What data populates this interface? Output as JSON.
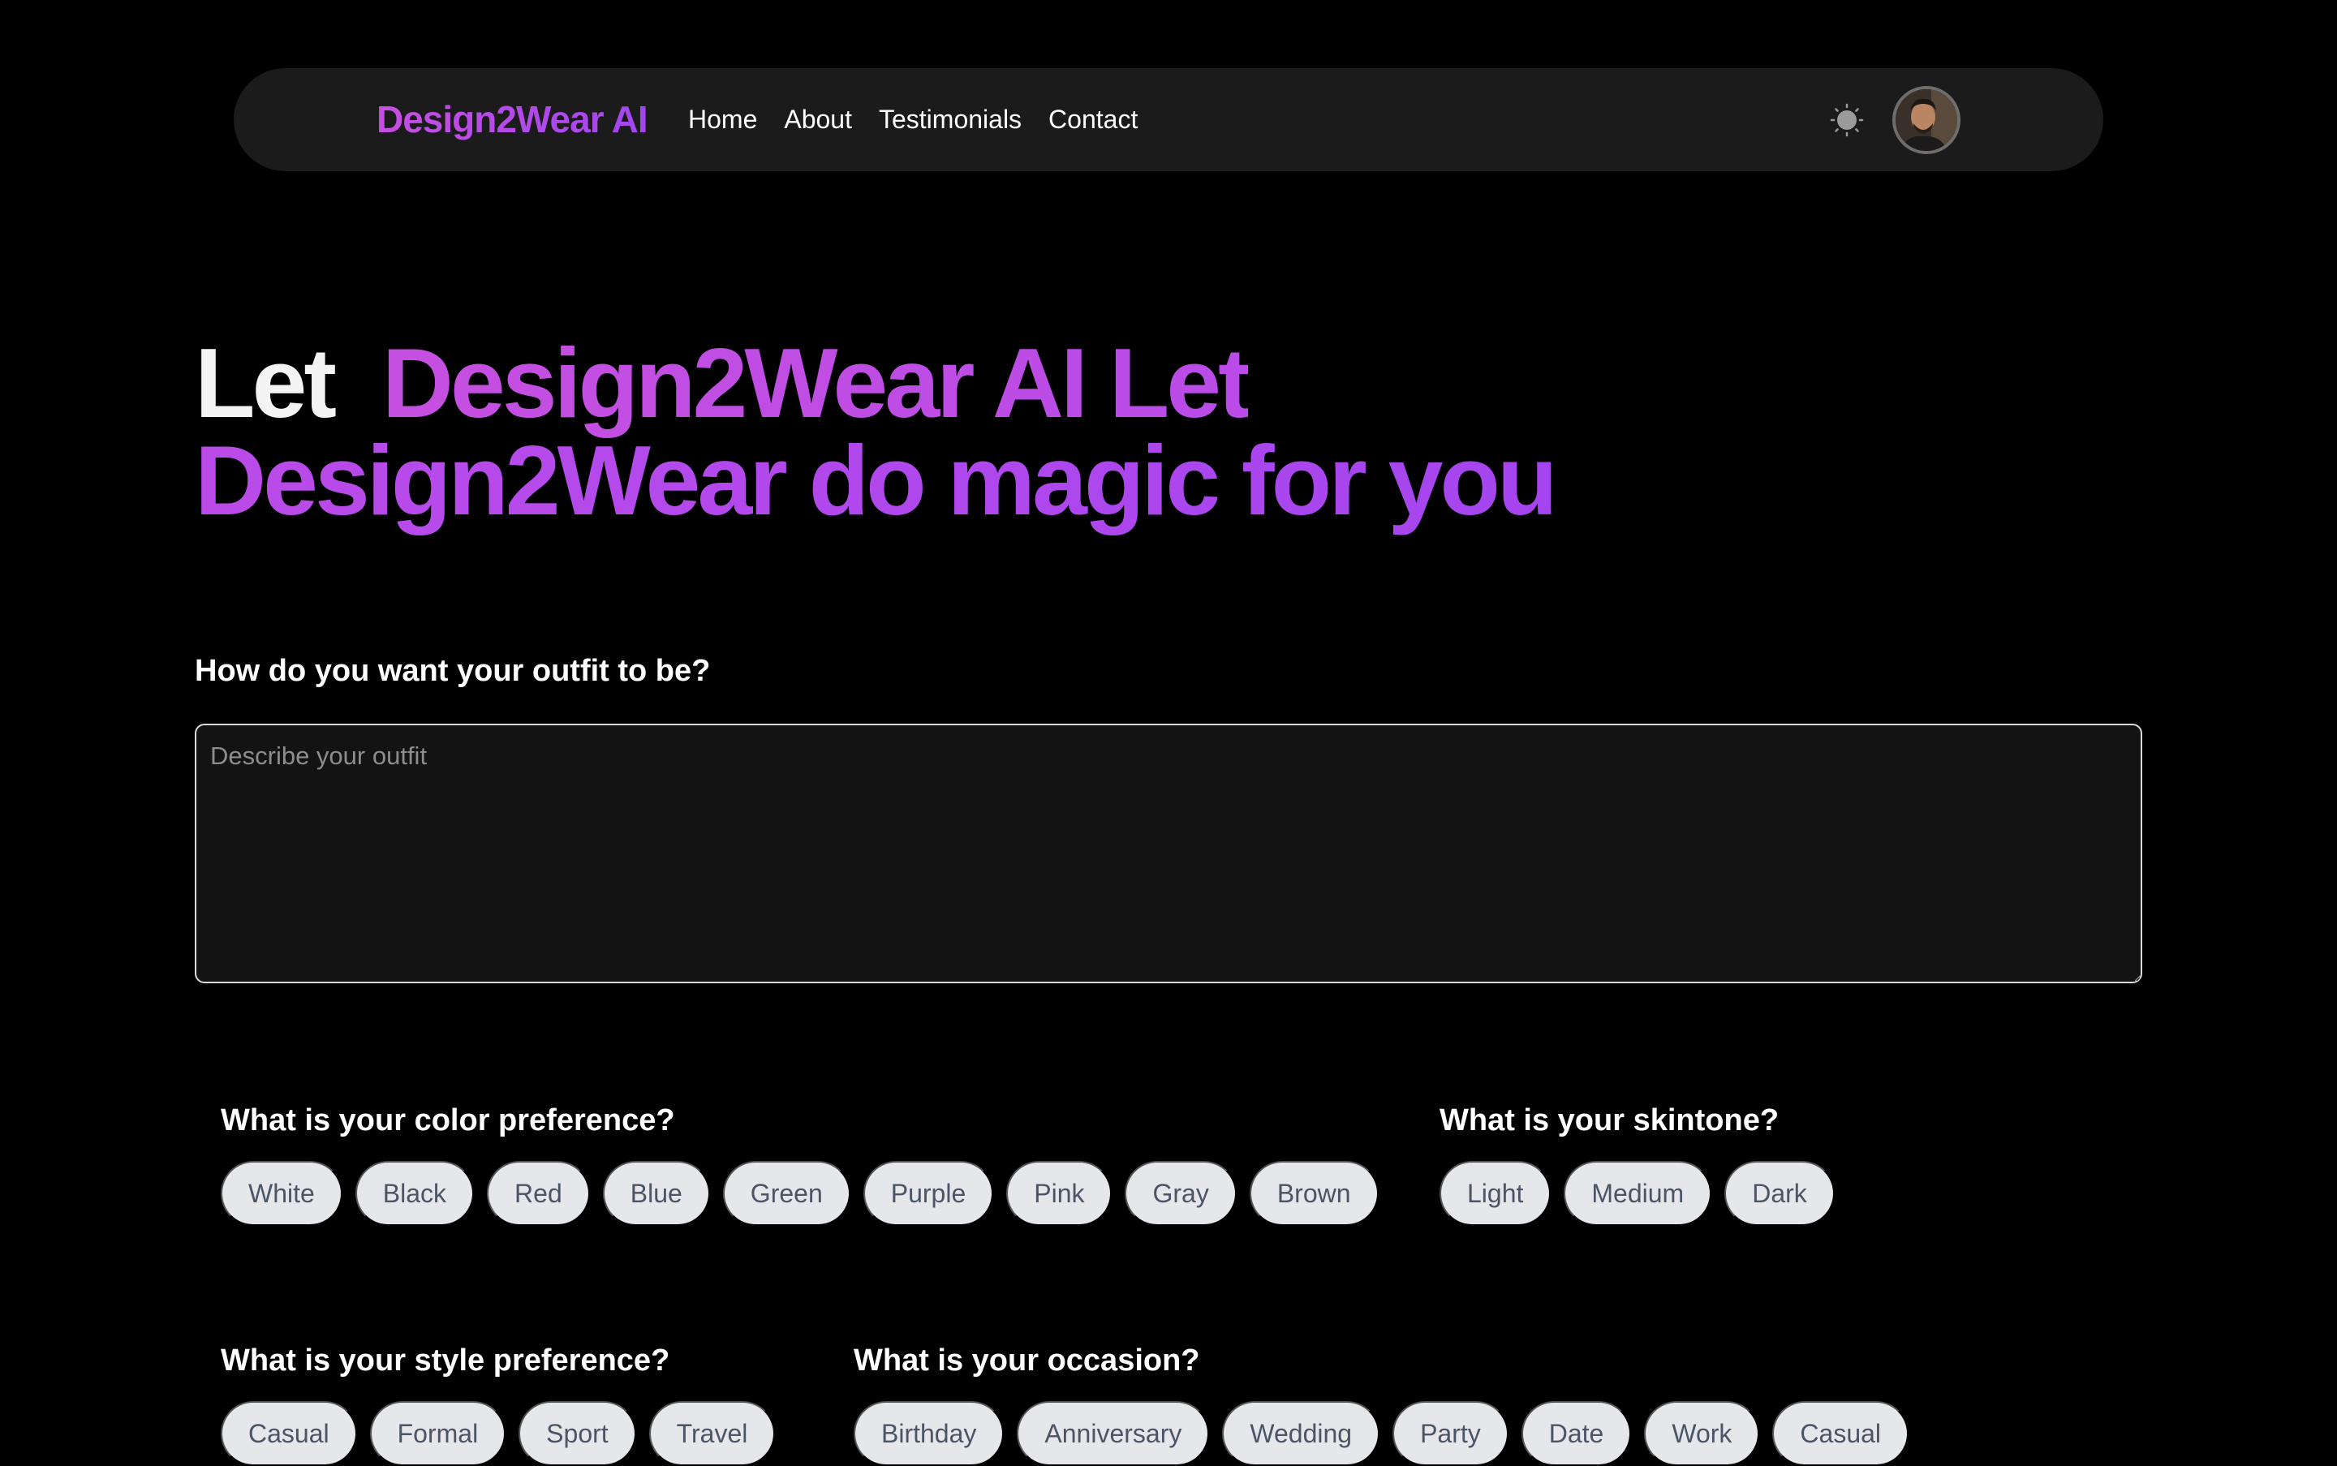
{
  "navbar": {
    "brand": "Design2Wear AI",
    "links": [
      "Home",
      "About",
      "Testimonials",
      "Contact"
    ]
  },
  "hero": {
    "prefix": "Let",
    "highlight": "Design2Wear AI Let Design2Wear do magic for you"
  },
  "outfit": {
    "label": "How do you want your outfit to be?",
    "placeholder": "Describe your outfit",
    "value": ""
  },
  "color_preference": {
    "label": "What is your color preference?",
    "options": [
      "White",
      "Black",
      "Red",
      "Blue",
      "Green",
      "Purple",
      "Pink",
      "Gray",
      "Brown"
    ]
  },
  "skintone": {
    "label": "What is your skintone?",
    "options": [
      "Light",
      "Medium",
      "Dark"
    ]
  },
  "style_preference": {
    "label": "What is your style preference?",
    "options": [
      "Casual",
      "Formal",
      "Sport",
      "Travel"
    ]
  },
  "occasion": {
    "label": "What is your occasion?",
    "options": [
      "Birthday",
      "Anniversary",
      "Wedding",
      "Party",
      "Date",
      "Work",
      "Casual"
    ]
  },
  "colors": {
    "accent_start": "#c64fe0",
    "accent_end": "#a245f0",
    "navbar_bg": "#1b1b1b",
    "pill_bg": "#e6e7eb",
    "pill_text": "#4b5565"
  },
  "icons": {
    "theme_toggle": "sun-icon",
    "avatar": "user-avatar"
  }
}
